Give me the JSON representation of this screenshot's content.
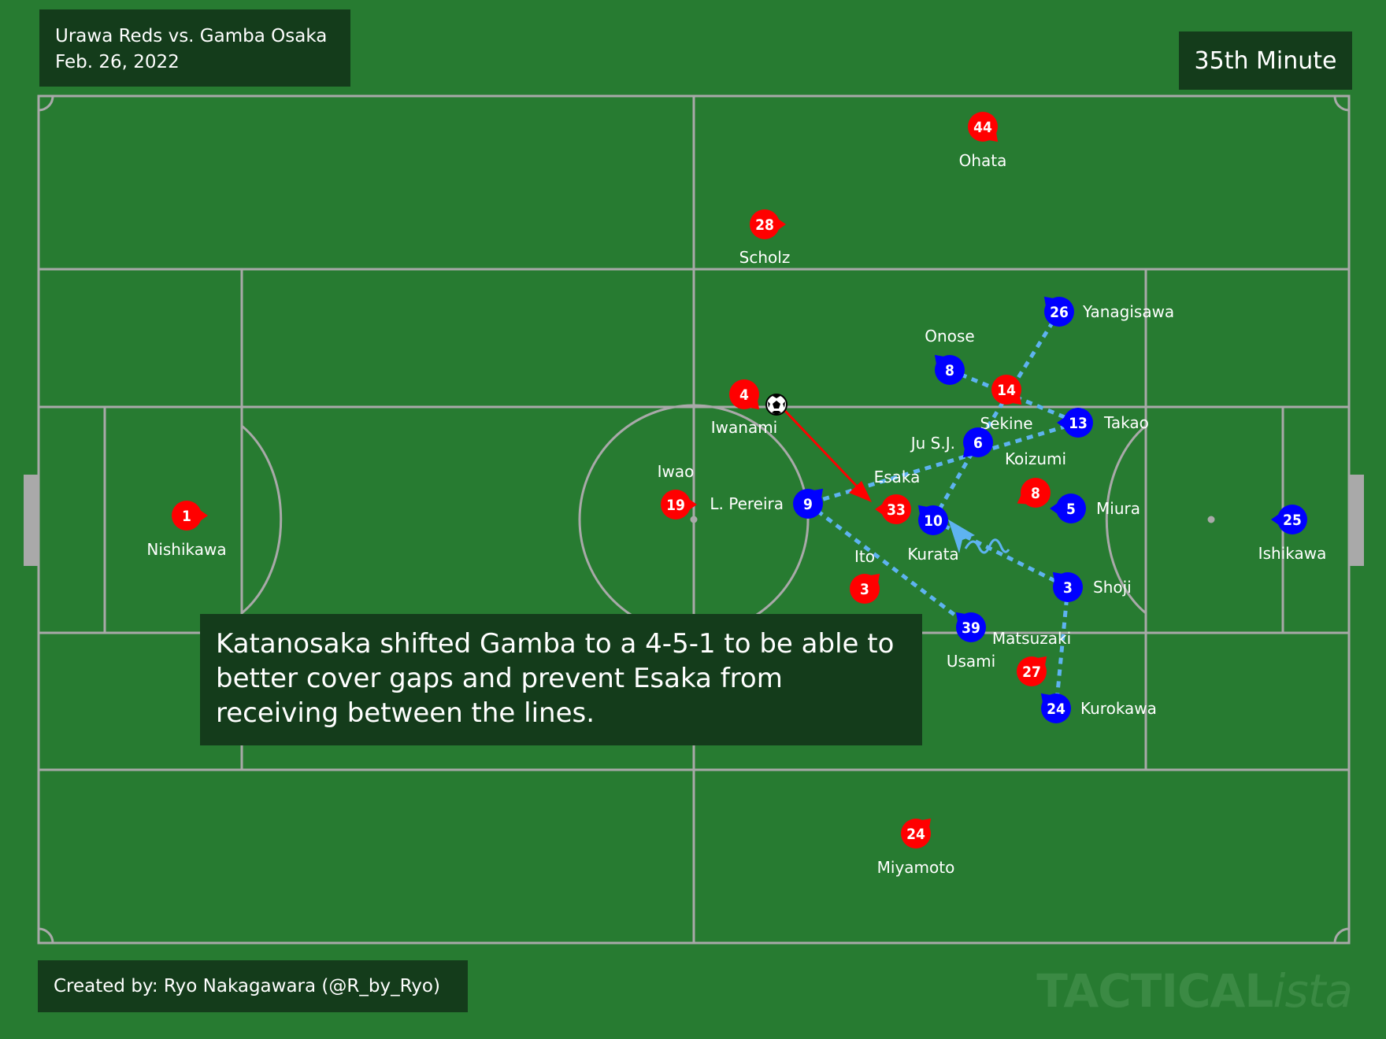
{
  "match": {
    "teams": "Urawa Reds vs. Gamba Osaka",
    "date": "Feb. 26, 2022"
  },
  "minute": "35th Minute",
  "caption": "Katanosaka shifted Gamba to a 4-5-1 to be able to better cover gaps and prevent Esaka from receiving between the lines.",
  "credit": "Created by: Ryo Nakagawara (@R_by_Ryo)",
  "watermark": {
    "main": "TACTICAL",
    "suffix": "ista"
  },
  "colors": {
    "pitch": "#277b31",
    "lines": "#a9a9a9",
    "panel": "#143c1b",
    "urawa": "#ff0000",
    "gamba": "#0000ff",
    "gamba_links": "#5eb3f0",
    "pass_arrow": "#ff0000"
  },
  "players": [
    {
      "team": "urawa",
      "number": "1",
      "name": "Nishikawa"
    },
    {
      "team": "urawa",
      "number": "44",
      "name": "Ohata"
    },
    {
      "team": "urawa",
      "number": "28",
      "name": "Scholz"
    },
    {
      "team": "urawa",
      "number": "4",
      "name": "Iwanami"
    },
    {
      "team": "urawa",
      "number": "14",
      "name": "Sekine"
    },
    {
      "team": "urawa",
      "number": "19",
      "name": "Iwao"
    },
    {
      "team": "urawa",
      "number": "33",
      "name": "Esaka"
    },
    {
      "team": "urawa",
      "number": "8",
      "name": "Koizumi"
    },
    {
      "team": "urawa",
      "number": "3",
      "name": "Ito"
    },
    {
      "team": "urawa",
      "number": "27",
      "name": "Matsuzaki"
    },
    {
      "team": "urawa",
      "number": "24",
      "name": "Miyamoto"
    },
    {
      "team": "gamba",
      "number": "26",
      "name": "Yanagisawa"
    },
    {
      "team": "gamba",
      "number": "8",
      "name": "Onose"
    },
    {
      "team": "gamba",
      "number": "6",
      "name": "Ju S.J."
    },
    {
      "team": "gamba",
      "number": "13",
      "name": "Takao"
    },
    {
      "team": "gamba",
      "number": "9",
      "name": "L. Pereira"
    },
    {
      "team": "gamba",
      "number": "10",
      "name": "Kurata"
    },
    {
      "team": "gamba",
      "number": "5",
      "name": "Miura"
    },
    {
      "team": "gamba",
      "number": "25",
      "name": "Ishikawa"
    },
    {
      "team": "gamba",
      "number": "3",
      "name": "Shoji"
    },
    {
      "team": "gamba",
      "number": "39",
      "name": "Usami"
    },
    {
      "team": "gamba",
      "number": "24",
      "name": "Kurokawa"
    }
  ]
}
